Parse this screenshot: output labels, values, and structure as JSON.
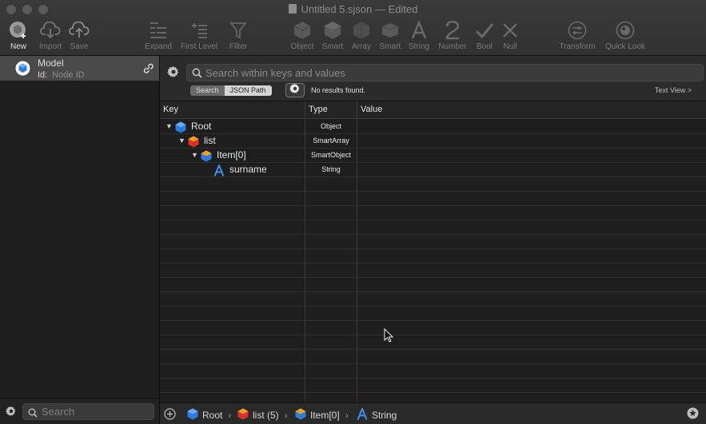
{
  "window": {
    "title": "Untitled 5.sjson — Edited"
  },
  "toolbar": {
    "new": "New",
    "import": "Import",
    "save": "Save",
    "expand": "Expand",
    "first_level": "First Level",
    "filter": "Filter",
    "object": "Object",
    "smart": "Smart",
    "array": "Array",
    "smart_array": "Smart",
    "string": "String",
    "number": "Number",
    "bool": "Bool",
    "null": "Null",
    "transform": "Transform",
    "quick_look": "Quick Look"
  },
  "sidebar": {
    "model_name": "Model",
    "id_label": "Id:",
    "id_placeholder": "Node ID",
    "search_placeholder": "Search"
  },
  "search": {
    "placeholder": "Search within keys and values",
    "modes": [
      "Search",
      "JSON Path"
    ],
    "selected_mode": "JSON Path",
    "status": "No results found.",
    "text_view": "Text View >"
  },
  "table": {
    "headers": {
      "key": "Key",
      "type": "Type",
      "value": "Value"
    },
    "rows": [
      {
        "key": "Root",
        "type": "Object",
        "icon": "object-cube-icon"
      },
      {
        "key": "list",
        "type": "SmartArray",
        "icon": "smart-array-cube-icon"
      },
      {
        "key": "Item[0]",
        "type": "SmartObject",
        "icon": "smart-object-cube-icon"
      },
      {
        "key": "surname",
        "type": "String",
        "icon": "string-a-icon"
      }
    ]
  },
  "breadcrumb": {
    "items": [
      "Root",
      "list (5)",
      "Item[0]",
      "String"
    ],
    "separator": "›"
  },
  "colors": {
    "blue": "#2f7de1",
    "red": "#e0312f",
    "orange": "#f4a21b"
  }
}
